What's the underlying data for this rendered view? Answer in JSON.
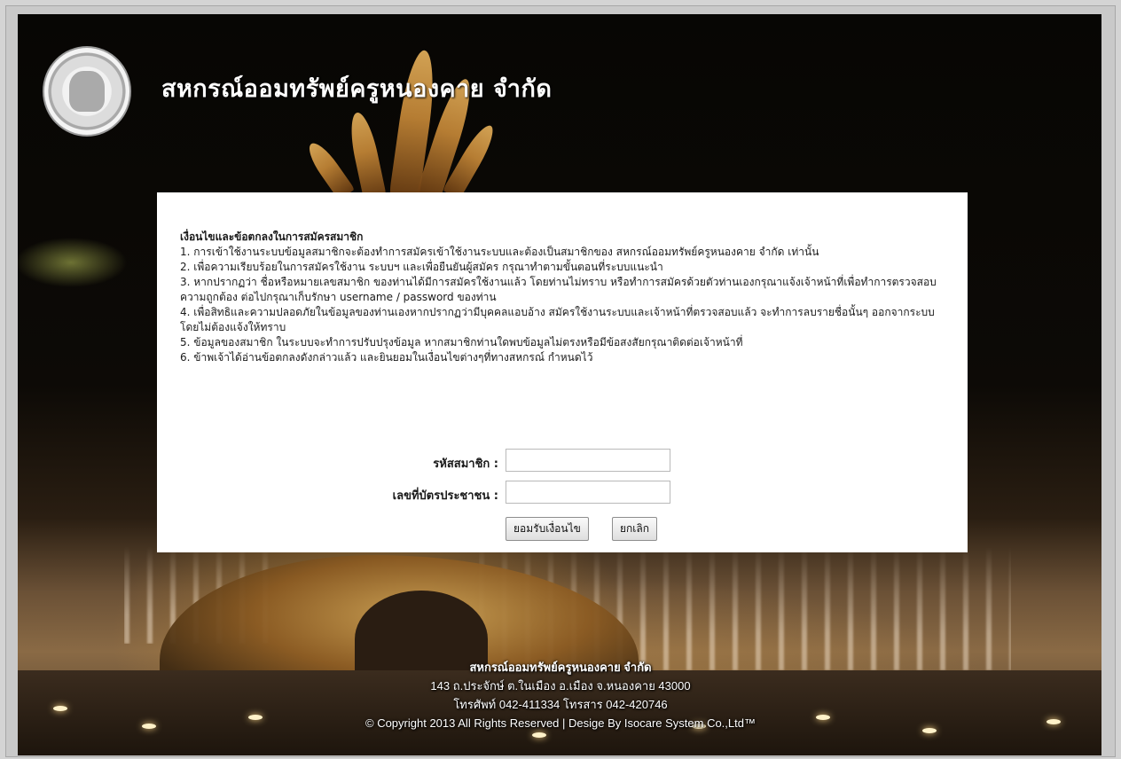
{
  "header": {
    "title": "สหกรณ์ออมทรัพย์ครูหนองคาย จำกัด",
    "logo_icon": "cooperative-seal-icon"
  },
  "terms": {
    "title": "เงื่อนไขและข้อตกลงในการสมัครสมาชิก",
    "items": [
      "1. การเข้าใช้งานระบบข้อมูลสมาชิกจะต้องทำการสมัครเข้าใช้งานระบบและต้องเป็นสมาชิกของ สหกรณ์ออมทรัพย์ครูหนองคาย จำกัด เท่านั้น",
      "2. เพื่อความเรียบร้อยในการสมัครใช้งาน ระบบฯ และเพื่อยืนยันผู้สมัคร กรุณาทำตามขั้นตอนที่ระบบแนะนำ",
      "3. หากปรากฏว่า ชื่อหรือหมายเลขสมาชิก ของท่านได้มีการสมัครใช้งานแล้ว โดยท่านไม่ทราบ หรือทำการสมัครด้วยตัวท่านเองกรุณาแจ้งเจ้าหน้าที่เพื่อทำการตรวจสอบความถูกต้อง ต่อไปกรุณาเก็บรักษา username / password ของท่าน",
      "4. เพื่อสิทธิและความปลอดภัยในข้อมูลของท่านเองหากปรากฏว่ามีบุคคลแอบอ้าง สมัครใช้งานระบบและเจ้าหน้าที่ตรวจสอบแล้ว จะทำการลบรายชื่อนั้นๆ ออกจากระบบ โดยไม่ต้องแจ้งให้ทราบ",
      "5. ข้อมูลของสมาชิก ในระบบจะทำการปรับปรุงข้อมูล หากสมาชิกท่านใดพบข้อมูลไม่ตรงหรือมีข้อสงสัยกรุณาติดต่อเจ้าหน้าที่",
      "6. ข้าพเจ้าได้อ่านข้อตกลงดังกล่าวแล้ว และยินยอมในเงื่อนไขต่างๆที่ทางสหกรณ์ กำหนดไว้"
    ]
  },
  "form": {
    "member_id_label": "รหัสสมาชิก :",
    "member_id_value": "",
    "id_card_label": "เลขที่บัตรประชาชน :",
    "id_card_value": "",
    "accept_button": "ยอมรับเงื่อนไข",
    "cancel_button": "ยกเลิก"
  },
  "footer": {
    "org_name": "สหกรณ์ออมทรัพย์ครูหนองคาย จำกัด",
    "address": "143 ถ.ประจักษ์ ต.ในเมือง อ.เมือง จ.หนองคาย 43000",
    "phone": "โทรศัพท์ 042-411334 โทรสาร 042-420746",
    "copyright": "© Copyright 2013 All Rights Reserved | Desige By Isocare System Co.,Ltd™"
  },
  "colors": {
    "panel_bg": "#ffffff",
    "title_text": "#ffffff"
  }
}
